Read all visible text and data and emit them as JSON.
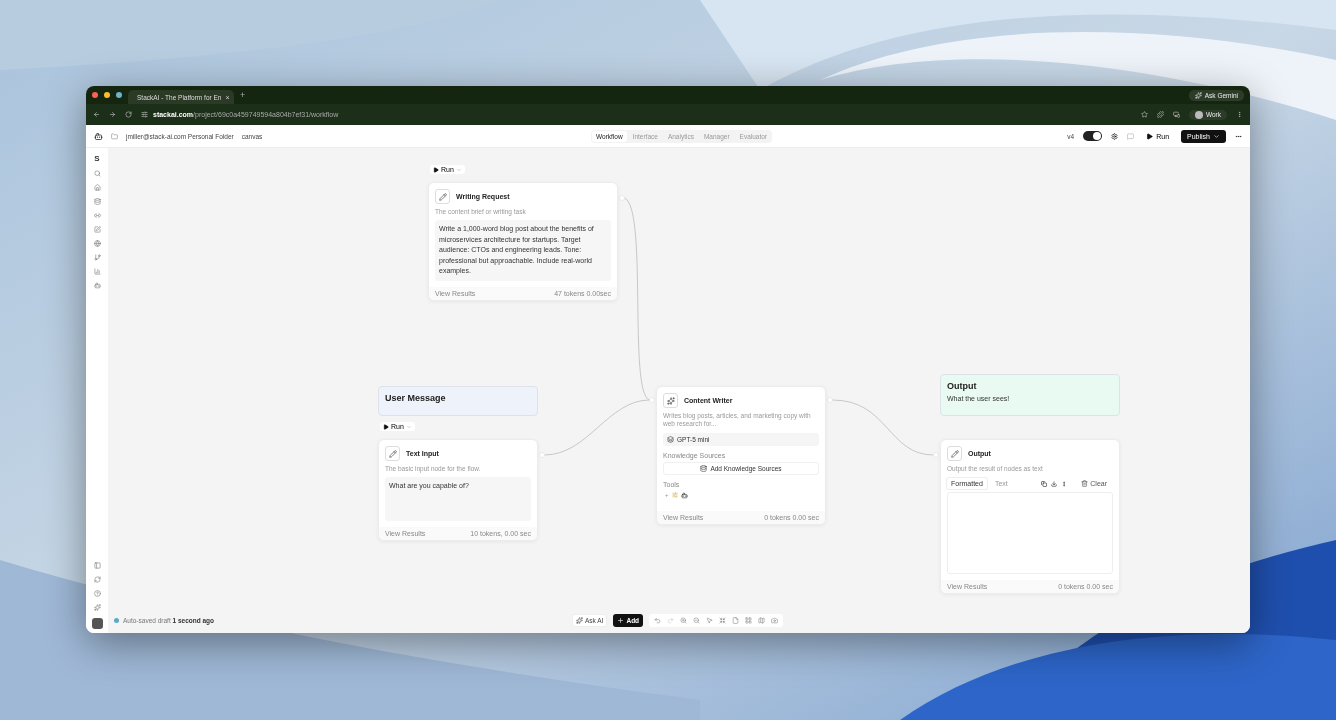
{
  "browser": {
    "tab_title": "StackAI - The Platform for En",
    "tab_close": "×",
    "new_tab": "+",
    "url_host": "stackai.com",
    "url_path": "/project/69c0a459749594a804b7ef31/workflow",
    "ask_gemini": "Ask Gemini",
    "profile": "Work"
  },
  "header": {
    "breadcrumb": "jmiller@stack-ai.com Personal Folder",
    "page": "canvas",
    "tabs": [
      {
        "label": "Workflow",
        "selected": true
      },
      {
        "label": "Interface",
        "selected": false
      },
      {
        "label": "Analytics",
        "selected": false
      },
      {
        "label": "Manager",
        "selected": false
      },
      {
        "label": "Evaluator",
        "selected": false
      }
    ],
    "version": "v4",
    "toggle_on": true,
    "run": "Run",
    "publish": "Publish"
  },
  "sidebar": {
    "workspace": "S"
  },
  "nodes": [
    {
      "kind": "input",
      "run": "Run",
      "title": "Writing Request",
      "description": "The content brief or writing task",
      "value": "Write a 1,000-word blog post about the benefits of microservices architecture for startups. Target audience: CTOs and engineering leads. Tone: professional but approachable. Include real-world examples.",
      "footer": "View Results",
      "stats": "47 tokens  0.00sec"
    },
    {
      "kind": "header",
      "title": "User Message",
      "color": "#edf2fb"
    },
    {
      "kind": "input",
      "run": "Run",
      "title": "Text Input",
      "description": "The basic input node for the flow.",
      "value": "What are you capable of?",
      "footer": "View Results",
      "stats": "10 tokens, 0.00 sec"
    },
    {
      "kind": "llm",
      "title": "Content Writer",
      "description": "Writes blog posts, articles, and marketing copy with web research for...",
      "model": "GPT-5 mini",
      "knowledge_label": "Knowledge Sources",
      "knowledge_button": "Add Knowledge Sources",
      "tools_label": "Tools",
      "tools_add": "+",
      "footer": "View Results",
      "stats": "0 tokens  0.00 sec"
    },
    {
      "kind": "header",
      "title": "Output",
      "subtitle": "What the user sees!",
      "color": "#e9faf3"
    },
    {
      "kind": "output",
      "title": "Output",
      "description": "Output the result of nodes as text",
      "tabs": [
        {
          "label": "Formatted",
          "selected": true
        },
        {
          "label": "Text",
          "selected": false
        }
      ],
      "clear": "Clear",
      "footer": "View Results",
      "stats": "0 tokens  0.00 sec"
    }
  ],
  "status": {
    "autosave": "Auto-saved draft **1 second ago**"
  },
  "toolbar": {
    "ask_ai": "Ask AI",
    "add": "Add"
  }
}
